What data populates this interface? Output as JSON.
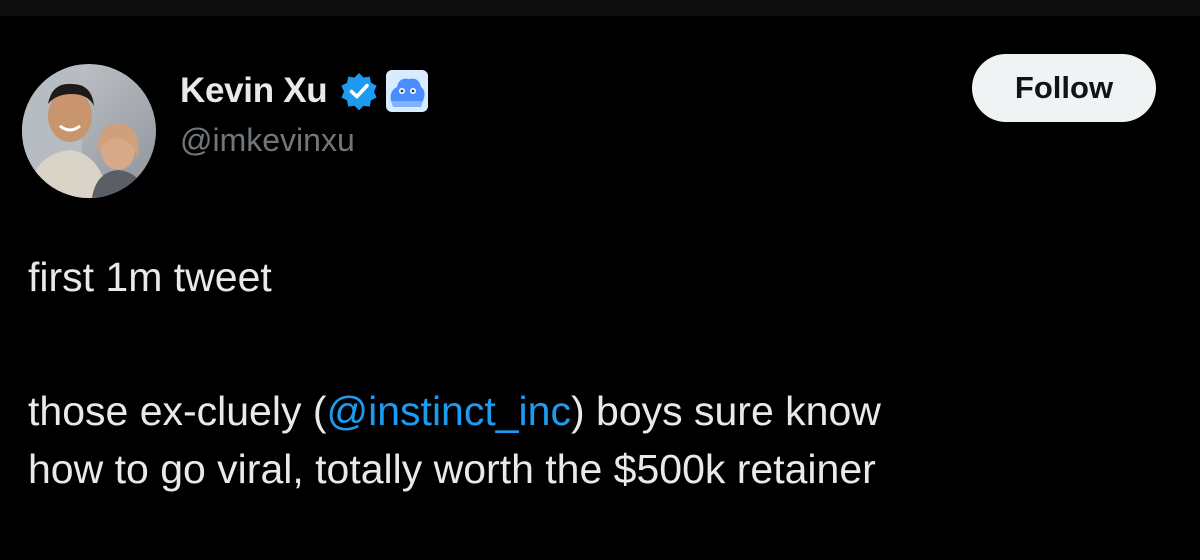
{
  "author": {
    "display_name": "Kevin Xu",
    "handle": "@imkevinxu",
    "badges": [
      "verified-badge-icon",
      "affiliate-badge-icon"
    ]
  },
  "follow_button": {
    "label": "Follow"
  },
  "tweet": {
    "line1": "first 1m tweet",
    "line2_before": "those ex-cluely (",
    "line2_mention": "@instinct_inc",
    "line2_after": ") boys sure know",
    "line3": "how to go viral, totally worth the $500k retainer"
  },
  "colors": {
    "background": "#000000",
    "text": "#e7e9ea",
    "secondary_text": "#71767b",
    "link": "#1d9bf0",
    "verified": "#1d9bf0",
    "follow_button_bg": "#eff3f4"
  }
}
